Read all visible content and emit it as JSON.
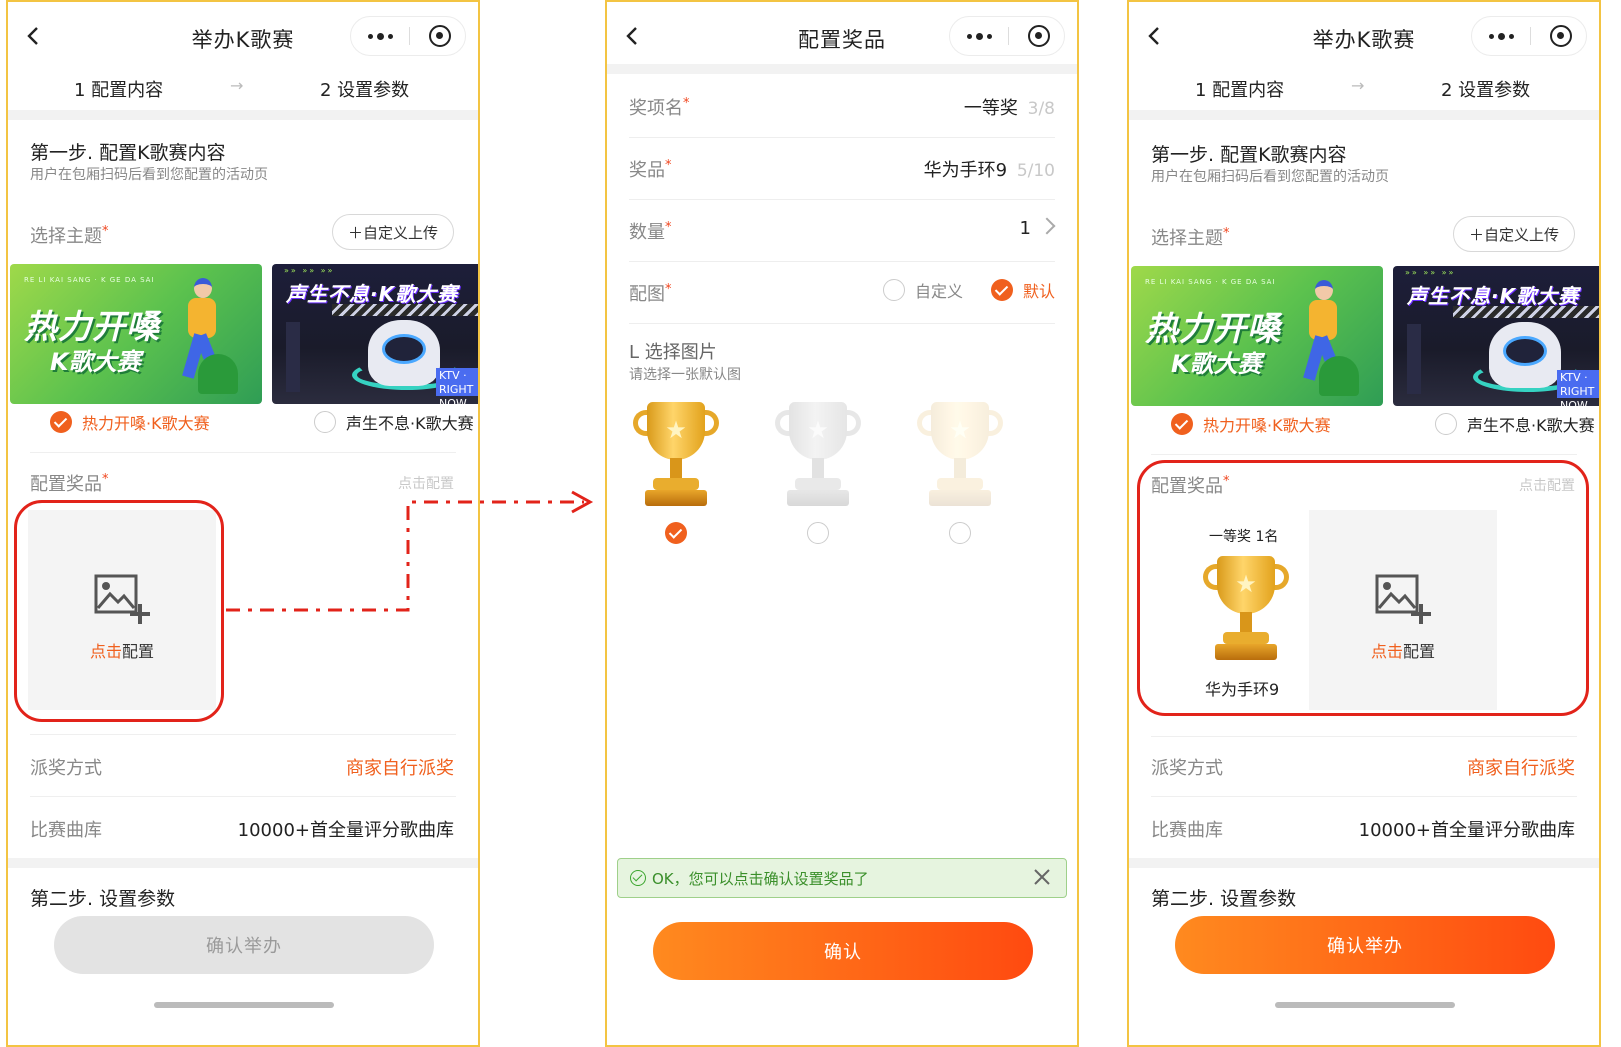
{
  "left": {
    "nav_title": "举办K歌赛",
    "step1": "1 配置内容",
    "step_arrow": "→",
    "step2": "2 设置参数",
    "section_title": "第一步. 配置K歌赛内容",
    "section_sub": "用户在包厢扫码后看到您配置的活动页",
    "theme_label": "选择主题",
    "upload_label": "＋自定义上传",
    "theme1_card_title": "热力开嗓",
    "theme1_card_sub": "K歌大赛",
    "theme1_card_tiny": "RE LI KAI SANG · K GE DA SAI",
    "theme2_card_title": "声生不息·K歌大赛",
    "theme2_card_tiny": "»» »» »»",
    "theme2_card_badge": "KTV · RIGHT NOW",
    "theme1_name": "热力开嗓·K歌大赛",
    "theme2_name": "声生不息·K歌大赛",
    "prize_label": "配置奖品",
    "prize_hint": "点击配置",
    "add_hl": "点击",
    "add_rest": "配置",
    "award_label": "派奖方式",
    "award_value": "商家自行派奖",
    "song_label": "比赛曲库",
    "song_value": "10000+首全量评分歌曲库",
    "step2_title": "第二步. 设置参数",
    "confirm": "确认举办"
  },
  "mid": {
    "nav_title": "配置奖品",
    "prize_name_label": "奖项名",
    "prize_name_value": "一等奖",
    "prize_name_count": "3/8",
    "item_label": "奖品",
    "item_value": "华为手环9",
    "item_count": "5/10",
    "qty_label": "数量",
    "qty_value": "1",
    "image_label": "配图",
    "opt_custom": "自定义",
    "opt_default": "默认",
    "pick_title": "L 选择图片",
    "pick_sub": "请选择一张默认图",
    "toast": "OK，您可以点击确认设置奖品了",
    "confirm": "确认"
  },
  "right": {
    "nav_title": "举办K歌赛",
    "step1": "1 配置内容",
    "step_arrow": "→",
    "step2": "2 设置参数",
    "section_title": "第一步. 配置K歌赛内容",
    "section_sub": "用户在包厢扫码后看到您配置的活动页",
    "theme_label": "选择主题",
    "upload_label": "＋自定义上传",
    "theme1_card_title": "热力开嗓",
    "theme1_card_sub": "K歌大赛",
    "theme1_card_tiny": "RE LI KAI SANG · K GE DA SAI",
    "theme2_card_title": "声生不息·K歌大赛",
    "theme2_card_tiny": "»» »» »»",
    "theme2_card_badge": "KTV · RIGHT NOW",
    "theme1_name": "热力开嗓·K歌大赛",
    "theme2_name": "声生不息·K歌大赛",
    "prize_label": "配置奖品",
    "prize_hint": "点击配置",
    "prize_card_title": "一等奖 1名",
    "prize_card_item": "华为手环9",
    "add_hl": "点击",
    "add_rest": "配置",
    "award_label": "派奖方式",
    "award_value": "商家自行派奖",
    "song_label": "比赛曲库",
    "song_value": "10000+首全量评分歌曲库",
    "step2_title": "第二步. 设置参数",
    "confirm": "确认举办"
  },
  "colors": {
    "frame": "#f3c443",
    "accent_orange": "#f0601e",
    "highlight_red": "#e2231a",
    "toast_green": "#3a8f2a"
  },
  "icons": [
    "back-chevron-icon",
    "more-dots-icon",
    "close-mini-program-icon",
    "image-add-icon",
    "trophy-icon",
    "check-circle-icon",
    "close-icon",
    "chevron-right-icon"
  ]
}
